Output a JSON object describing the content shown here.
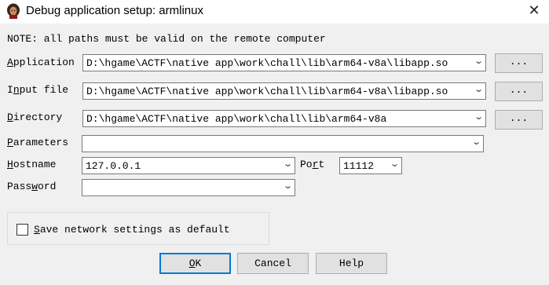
{
  "window": {
    "title": "Debug application setup: armlinux",
    "close_glyph": "✕",
    "app_icon": "ida-portrait-icon"
  },
  "note": "NOTE: all paths must be valid on the remote computer",
  "fields": {
    "application": {
      "label_mnemonic": "A",
      "label_rest": "pplication",
      "value": "D:\\hgame\\ACTF\\native app\\work\\chall\\lib\\arm64-v8a\\libapp.so",
      "browse_label": "..."
    },
    "input_file": {
      "label_pre": "I",
      "label_mnemonic": "n",
      "label_rest": "put file",
      "value": "D:\\hgame\\ACTF\\native app\\work\\chall\\lib\\arm64-v8a\\libapp.so",
      "browse_label": "..."
    },
    "directory": {
      "label_mnemonic": "D",
      "label_rest": "irectory",
      "value": "D:\\hgame\\ACTF\\native app\\work\\chall\\lib\\arm64-v8a",
      "browse_label": "..."
    },
    "parameters": {
      "label_mnemonic": "P",
      "label_rest": "arameters",
      "value": ""
    },
    "hostname": {
      "label_mnemonic": "H",
      "label_rest": "ostname",
      "value": "127.0.0.1"
    },
    "port": {
      "label_pre": "Po",
      "label_mnemonic": "r",
      "label_rest": "t",
      "value": "11112"
    },
    "password": {
      "label_pre": "Pass",
      "label_mnemonic": "w",
      "label_rest": "ord",
      "value": ""
    }
  },
  "save_default": {
    "mnemonic": "S",
    "rest": "ave network settings as default",
    "checked": false
  },
  "buttons": {
    "ok": {
      "mnemonic": "O",
      "rest": "K"
    },
    "cancel": "Cancel",
    "help": "Help"
  },
  "colors": {
    "accent": "#0078d7",
    "background": "#f0f0f0"
  }
}
